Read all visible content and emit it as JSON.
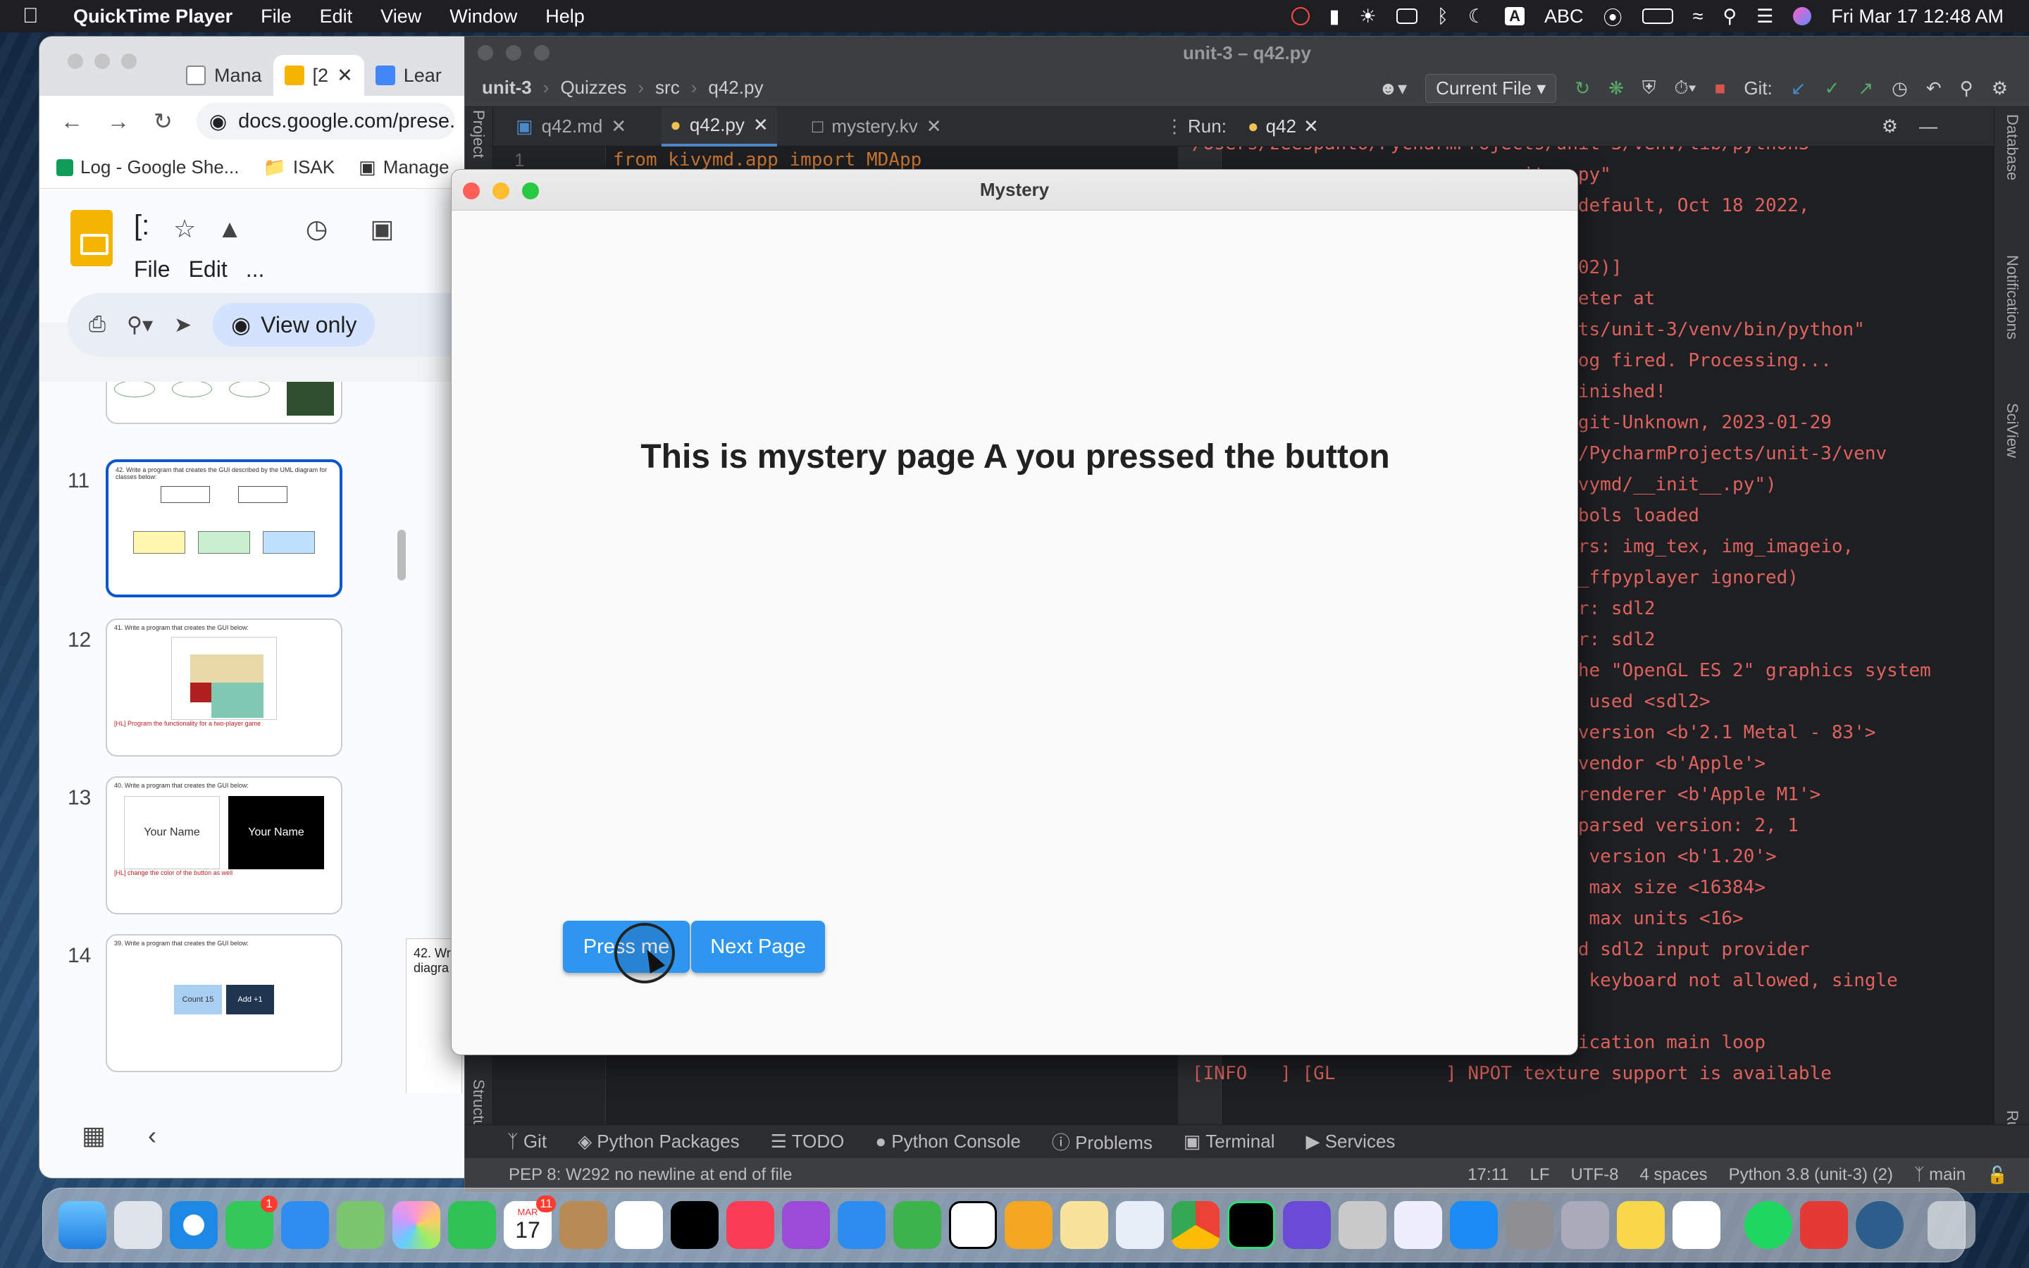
{
  "menubar": {
    "app_name": "QuickTime Player",
    "menus": [
      "File",
      "Edit",
      "View",
      "Window",
      "Help"
    ],
    "input_source": "ABC",
    "input_badge": "A",
    "datetime": "Fri Mar 17  12:48 AM"
  },
  "browser": {
    "tabs": [
      {
        "label": "Mana",
        "icon": "meet-icon"
      },
      {
        "label": "[2",
        "icon": "slides-icon"
      },
      {
        "label": "Lear",
        "icon": "docs-icon"
      }
    ],
    "url": "docs.google.com/prese...",
    "bookmarks": [
      "Log - Google She...",
      "ISAK",
      "Manage"
    ],
    "doc_title": "[:",
    "menu": [
      "File",
      "Edit",
      "..."
    ],
    "view_only_label": "View only",
    "slides": [
      {
        "num": "11",
        "caption": "42. Write a program that creates the GUI described by the UML diagram for classes below:"
      },
      {
        "num": "12",
        "caption": "41. Write a program that creates the GUI below:",
        "note": "[HL] Program the functionality for a two-player game"
      },
      {
        "num": "13",
        "caption": "40. Write a program that creates the GUI below:",
        "note": "[HL] change the color of the button as well",
        "label_a": "Your Name",
        "label_b": "Your Name"
      },
      {
        "num": "14",
        "caption": "39. Write a program that creates the GUI below:",
        "btn_a": "Count 15",
        "btn_b": "Add +1"
      }
    ],
    "stage_text": "42. Wr diagra"
  },
  "ide": {
    "window_title": "unit-3 – q42.py",
    "breadcrumb": [
      "unit-3",
      "Quizzes",
      "src",
      "q42.py"
    ],
    "run_config": "Current File",
    "git_label": "Git:",
    "editor_tabs": [
      "q42.md",
      "q42.py",
      "mystery.kv"
    ],
    "code_peek": "from kivymd.app import MDApp",
    "line_number": "1",
    "run_label": "Run:",
    "run_tab": "q42",
    "console_lines": [
      "/Users/zeespanto/PycharmProjects/unit-3/venv/lib/python3",
      "                              it__.py\"",
      "                              8.9 (default, Oct 18 2022,",
      "",
      "                              .29.202)]",
      "                              terpreter at",
      "                              rojects/unit-3/venv/bin/python\"",
      "                              rge log fired. Processing...",
      "                              rge finished!",
      "                              1.1, git-Unknown, 2023-01-29",
      "                              panto/PycharmProjects/unit-3/venv",
      "                              es/kivymd/__init__.py\")",
      "                              9 symbols loaded",
      "                              oviders: img_tex, img_imageio,",
      "                               (img_ffpyplayer ignored)",
      "                              ovider: sdl2",
      "                              ovider: sdl2",
      "                              ing the \"OpenGL ES 2\" graphics system",
      "                              ckend used <sdl2>",
      "                              enGL version <b'2.1 Metal - 83'>",
      "                              enGL vendor <b'Apple'>",
      "                              enGL renderer <b'Apple M1'>",
      "                              enGL parsed version: 2, 1",
      "                              ading version <b'1.20'>",
      "                              xture max size <16384>",
      "                              xture max units <16>",
      "                              to add sdl2 input provider",
      "                              rtual keyboard not allowed, single",
      "",
      "[INFO   ] [Base        ] Start application main loop",
      "[INFO   ] [GL          ] NPOT texture support is available"
    ],
    "tool_windows": [
      "Git",
      "Python Packages",
      "TODO",
      "Python Console",
      "Problems",
      "Terminal",
      "Services"
    ],
    "left_labels": [
      "Project",
      "Structure"
    ],
    "right_labels": [
      "Database",
      "Notifications",
      "SciView",
      "Run"
    ],
    "status_message": "PEP 8: W292 no newline at end of file",
    "status_right": [
      "17:11",
      "LF",
      "UTF-8",
      "4 spaces",
      "Python 3.8 (unit-3) (2)",
      "main"
    ]
  },
  "mystery": {
    "title": "Mystery",
    "heading": "This is mystery page A you pressed the button",
    "press_button": "Press me",
    "next_button": "Next Page",
    "button_color": "#2e96f1"
  },
  "dock": {
    "calendar_month": "MAR",
    "calendar_day": "17",
    "messages_badge": "1",
    "reminders_badge": "11"
  }
}
